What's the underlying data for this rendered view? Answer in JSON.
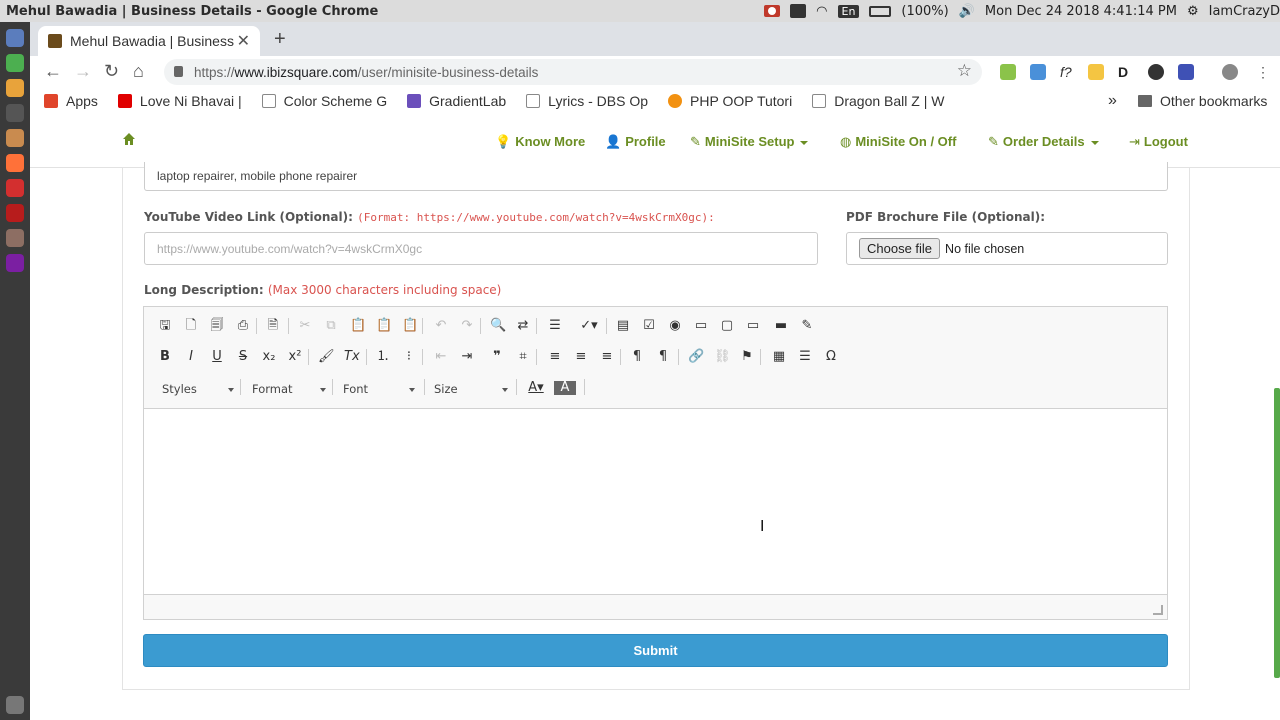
{
  "os": {
    "window_title": "Mehul Bawadia | Business Details - Google Chrome",
    "tray": {
      "lang": "En",
      "battery": "(100%)",
      "datetime": "Mon Dec 24 2018  4:41:14 PM",
      "user": "IamCrazyD"
    }
  },
  "browser": {
    "tab_title": "Mehul Bawadia | Business",
    "url_prefix": "https://",
    "url_domain": "www.ibizsquare.com",
    "url_path": "/user/minisite-business-details",
    "bookmarks": [
      {
        "label": "Apps",
        "color": "#e0452b"
      },
      {
        "label": "Love Ni Bhavai |",
        "color": "#e00000"
      },
      {
        "label": "Color Scheme G",
        "color": "#888888"
      },
      {
        "label": "GradientLab",
        "color": "#6b4fbb"
      },
      {
        "label": "Lyrics - DBS Op",
        "color": "#888888"
      },
      {
        "label": "PHP OOP Tutori",
        "color": "#f29111"
      },
      {
        "label": "Dragon Ball Z | W",
        "color": "#888888"
      }
    ],
    "more": "»",
    "other_bookmarks": "Other bookmarks"
  },
  "nav": {
    "items": [
      {
        "icon": "💡",
        "label": "Know More"
      },
      {
        "icon": "👤",
        "label": "Profile"
      },
      {
        "icon": "✎",
        "label": "MiniSite Setup"
      },
      {
        "icon": "◍",
        "label": "MiniSite On / Off"
      },
      {
        "icon": "✎",
        "label": "Order Details"
      },
      {
        "icon": "⇥",
        "label": "Logout"
      }
    ]
  },
  "form": {
    "keywords_value": "laptop repairer, mobile phone repairer",
    "youtube_label": "YouTube Video Link (Optional):",
    "youtube_hint": "(Format: https://www.youtube.com/watch?v=4wskCrmX0gc):",
    "youtube_placeholder": "https://www.youtube.com/watch?v=4wskCrmX0gc",
    "pdf_label": "PDF Brochure File (Optional):",
    "choose_file": "Choose file",
    "no_file": "No file chosen",
    "long_desc_label": "Long Description:",
    "long_desc_hint": "(Max 3000 characters including space)",
    "combos": {
      "styles": "Styles",
      "format": "Format",
      "font": "Font",
      "size": "Size"
    },
    "submit": "Submit"
  },
  "colors": {
    "accent_green": "#6b8e23",
    "submit_blue": "#3b9bd1",
    "hint_red": "#d9534f"
  }
}
